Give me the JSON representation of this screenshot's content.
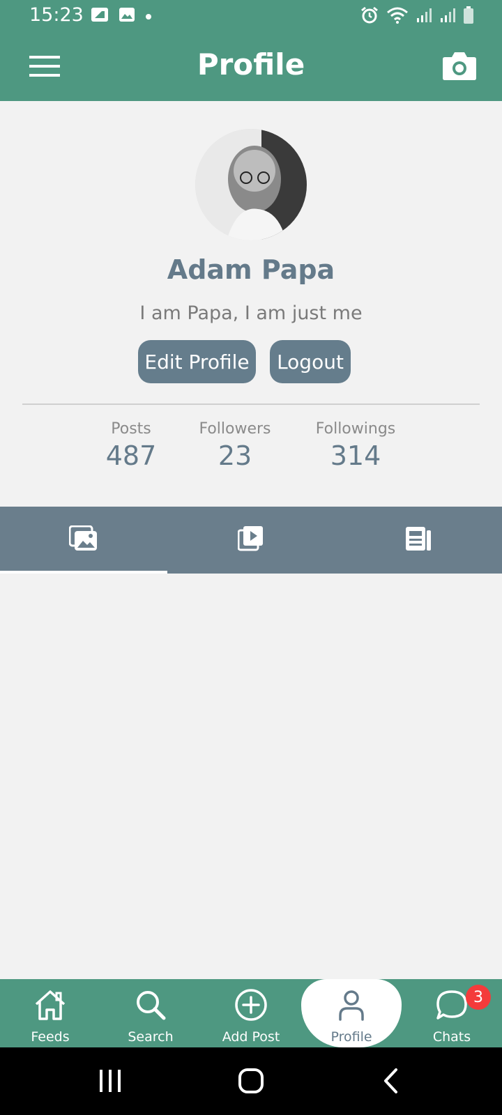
{
  "status_bar": {
    "time": "15:23",
    "left_icons": [
      "sim-card-icon",
      "image-icon",
      "dot-icon"
    ],
    "right_icons": [
      "alarm-icon",
      "wifi-icon",
      "signal-icon",
      "signal-icon",
      "battery-icon"
    ]
  },
  "app_bar": {
    "title": "Profile",
    "menu_icon": "hamburger-menu-icon",
    "camera_icon": "camera-icon"
  },
  "profile": {
    "name": "Adam Papa",
    "bio": "I am Papa, I am just me",
    "edit_label": "Edit Profile",
    "logout_label": "Logout"
  },
  "stats": [
    {
      "label": "Posts",
      "value": "487"
    },
    {
      "label": "Followers",
      "value": "23"
    },
    {
      "label": "Followings",
      "value": "314"
    }
  ],
  "content_tabs": [
    {
      "icon": "photos-icon",
      "active": true
    },
    {
      "icon": "video-icon",
      "active": false
    },
    {
      "icon": "article-icon",
      "active": false
    }
  ],
  "bottom_nav": [
    {
      "label": "Feeds",
      "icon": "home-icon"
    },
    {
      "label": "Search",
      "icon": "search-icon"
    },
    {
      "label": "Add Post",
      "icon": "add-circle-icon"
    },
    {
      "label": "Profile",
      "icon": "person-icon",
      "active": true
    },
    {
      "label": "Chats",
      "icon": "chat-icon",
      "badge": "3"
    }
  ],
  "colors": {
    "primary": "#4e9881",
    "slate": "#647a8a",
    "background": "#f2f2f2",
    "badge": "#f43b3b"
  }
}
